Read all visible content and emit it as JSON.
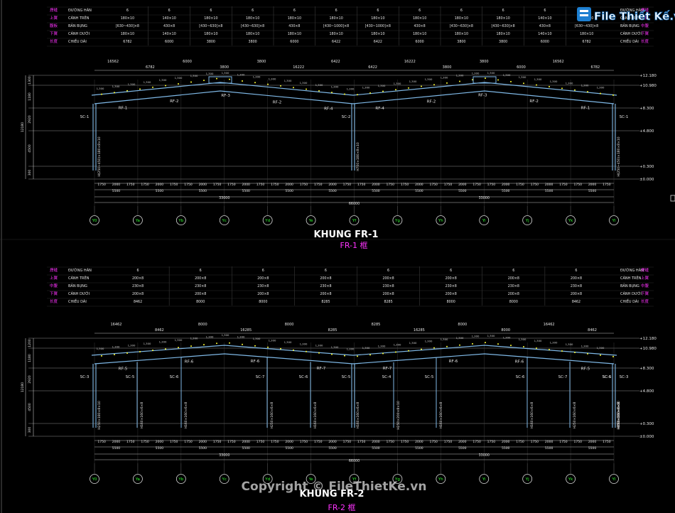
{
  "window": {
    "title": "KHUNG FR-1 / KHUNG FR-2"
  },
  "colors": {
    "background": "#000000",
    "frame": "#7fb8e6",
    "dimension": "#bfbfbf",
    "magenta": "#ff33ff",
    "yellow": "#ffff33",
    "grid": "#3a3a3a",
    "white": "#ffffff"
  },
  "logo": {
    "name": "File Thiết Kế.vn",
    "icon": "file-logo-icon"
  },
  "watermark": "Copyright © FileThietKe.vn",
  "drawings": [
    {
      "title": "KHUNG FR-1",
      "subtitle": "FR-1 框",
      "table": {
        "left_codes": [
          "焊缝",
          "上翼",
          "腹板",
          "下翼",
          "长度"
        ],
        "left_labels": [
          "ĐƯỜNG HÀN",
          "CÁNH TRÊN",
          "BẢN BỤNG",
          "CÁNH DƯỚI",
          "CHIỀU DÀI"
        ],
        "right_labels": [
          "ĐƯỜNG HÀN",
          "CÁNH TRÊN",
          "BẢN BỤNG",
          "CÁNH DƯỚI",
          "CHIỀU DÀI"
        ],
        "right_codes": [
          "焊缝",
          "上翼",
          "中腹",
          "下翼",
          "长度"
        ],
        "columns": [
          [
            "6",
            "180×10",
            "[630~430]×8",
            "180×10",
            "6782"
          ],
          [
            "6",
            "140×10",
            "430×8",
            "140×10",
            "6000"
          ],
          [
            "6",
            "180×10",
            "[430~630]×8",
            "180×10",
            "3800"
          ],
          [
            "6",
            "180×10",
            "[430~630]×8",
            "180×10",
            "3800"
          ],
          [
            "6",
            "180×10",
            "430×8",
            "180×10",
            "6000"
          ],
          [
            "6",
            "180×10",
            "[430~1000]×8",
            "180×10",
            "6422"
          ],
          [
            "6",
            "180×10",
            "[430~1000]×8",
            "180×10",
            "6422"
          ],
          [
            "6",
            "180×10",
            "430×8",
            "180×10",
            "6000"
          ],
          [
            "6",
            "180×10",
            "[430~630]×8",
            "180×10",
            "3800"
          ],
          [
            "6",
            "180×10",
            "[430~630]×8",
            "180×10",
            "3800"
          ],
          [
            "6",
            "140×10",
            "430×8",
            "140×10",
            "6000"
          ],
          [
            "6",
            "180×10",
            "[630~430]×8",
            "180×10",
            "6782"
          ]
        ]
      },
      "top_dims": [
        "16562",
        "6782",
        "6000",
        "3800",
        "3800",
        "16222",
        "6422",
        "6422",
        "16222",
        "3800",
        "3800",
        "6000",
        "16562",
        "6782"
      ],
      "rafters": [
        "RF-1",
        "RF-2",
        "RF-3",
        "RF-2",
        "RF-4",
        "RF-4",
        "RF-2",
        "RF-3",
        "RF-2",
        "RF-1"
      ],
      "columns_lbl": [
        "SC-1",
        "SC-2",
        "SC-1"
      ],
      "column_sections": [
        "H(250~450)×180×8×10",
        "H700×180×8×10",
        "H(250~450)×180×8×10"
      ],
      "levels_right": [
        "+12.180",
        "+10.980",
        "+8.300",
        "+4.800",
        "+0.300",
        "±0.000"
      ],
      "left_dims_v": [
        "1300",
        "1180",
        "2920",
        "4500",
        "300",
        "12180"
      ],
      "bay_small": [
        "1750",
        "2000",
        "1750"
      ],
      "bay_mid": [
        "5500",
        "5500",
        "5500",
        "5500",
        "5500",
        "5500",
        "5500",
        "5500",
        "5500",
        "5500",
        "5500",
        "5500"
      ],
      "half_total": [
        "33000",
        "33000"
      ],
      "total": "66000",
      "axes": [
        "Y0",
        "Ya",
        "Yb",
        "Yc",
        "Yd",
        "Ye",
        "Yf",
        "Yg",
        "Yh",
        "Yi",
        "Yj",
        "Yk",
        "Yl"
      ]
    },
    {
      "title": "KHUNG FR-2",
      "subtitle": "FR-2 框",
      "table": {
        "left_codes": [
          "焊缝",
          "上翼",
          "中腹",
          "下翼",
          "长度"
        ],
        "left_labels": [
          "ĐƯỜNG HÀN",
          "CÁNH TRÊN",
          "BẢN BỤNG",
          "CÁNH DƯỚI",
          "CHIỀU DÀI"
        ],
        "right_labels": [
          "ĐƯỜNG HÀN",
          "CÁNH TRÊN",
          "BẢN BỤNG",
          "CÁNH DƯỚI",
          "CHIỀU DÀI"
        ],
        "right_codes": [
          "焊缝",
          "上翼",
          "中腹",
          "下翼",
          "长度"
        ],
        "columns": [
          [
            "6",
            "200×8",
            "230×8",
            "200×8",
            "8462"
          ],
          [
            "6",
            "200×8",
            "230×8",
            "200×8",
            "8000"
          ],
          [
            "6",
            "200×8",
            "230×8",
            "200×8",
            "8000"
          ],
          [
            "6",
            "200×8",
            "230×8",
            "200×8",
            "8285"
          ],
          [
            "6",
            "200×8",
            "230×8",
            "200×8",
            "8285"
          ],
          [
            "6",
            "200×8",
            "230×8",
            "200×8",
            "8000"
          ],
          [
            "6",
            "200×8",
            "230×8",
            "200×8",
            "8000"
          ],
          [
            "6",
            "200×8",
            "230×8",
            "200×8",
            "8462"
          ]
        ]
      },
      "top_dims": [
        "16462",
        "8462",
        "8000",
        "16285",
        "8000",
        "8285",
        "8285",
        "16285",
        "8000",
        "8000",
        "16462",
        "8462"
      ],
      "rafters": [
        "RF-5",
        "RF-6",
        "RF-6",
        "RF-7",
        "RF-7",
        "RF-6",
        "RF-6",
        "RF-5"
      ],
      "columns_lbl": [
        "SC-3",
        "SC-5",
        "SC-6",
        "SC-7",
        "SC-6",
        "SC-5",
        "SC-4",
        "SC-5",
        "SC-6",
        "SC-7",
        "SC-6",
        "SC-5",
        "SC-3"
      ],
      "column_sections": [
        "H250×180×8×10",
        "H160×160×6×8",
        "H160×160×6×8",
        "H250×160×6×8",
        "H160×160×6×8",
        "H160×160×6×8",
        "H250×200×8×10",
        "H160×160×6×8",
        "H160×160×6×8",
        "H250×160×6×8",
        "H160×160×6×8",
        "H160×160×6×8",
        "H250×180×8×10"
      ],
      "levels_right": [
        "+12.180",
        "+10.980",
        "+8.300",
        "+4.800",
        "+0.300",
        "±0.000"
      ],
      "left_dims_v": [
        "1200",
        "1180",
        "2920",
        "4500",
        "300",
        "12180"
      ],
      "bay_small": [
        "1750",
        "2000",
        "1750"
      ],
      "bay_mid": [
        "5500",
        "5500",
        "5500",
        "5500",
        "5500",
        "5500",
        "5500",
        "5500",
        "5500",
        "5500",
        "5500",
        "5500"
      ],
      "half_total": [
        "33000",
        "33000"
      ],
      "total": "66000",
      "axes": [
        "Y0",
        "Ya",
        "Yb",
        "Yc",
        "Yd",
        "Ye",
        "Yf",
        "Yg",
        "Yh",
        "Yi",
        "Yj",
        "Yk",
        "Yl"
      ]
    }
  ]
}
